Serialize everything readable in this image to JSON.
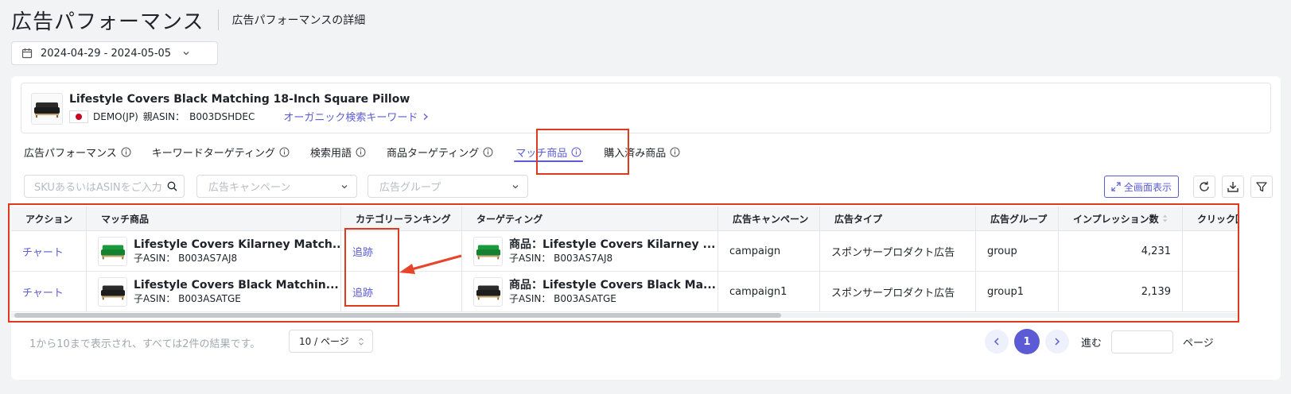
{
  "header": {
    "title": "広告パフォーマンス",
    "subtitle": "広告パフォーマンスの詳細"
  },
  "date_range": {
    "value": "2024-04-29 - 2024-05-05"
  },
  "product": {
    "name": "Lifestyle Covers Black Matching 18-Inch Square Pillow",
    "store": "DEMO(JP)",
    "parent_asin_label": "親ASIN：",
    "parent_asin": "B003DSHDEC",
    "organic_link": "オーガニック検索キーワード"
  },
  "tabs": [
    {
      "label": "広告パフォーマンス",
      "active": false
    },
    {
      "label": "キーワードターゲティング",
      "active": false
    },
    {
      "label": "検索用語",
      "active": false
    },
    {
      "label": "商品ターゲティング",
      "active": false
    },
    {
      "label": "マッチ商品",
      "active": true
    },
    {
      "label": "購入済み商品",
      "active": false
    }
  ],
  "filters": {
    "search_placeholder": "SKUあるいはASINをご入力",
    "campaign_placeholder": "広告キャンペーン",
    "adgroup_placeholder": "広告グループ"
  },
  "toolbar": {
    "fullscreen_label": "全画面表示"
  },
  "table": {
    "columns": [
      "アクション",
      "マッチ商品",
      "カテゴリーランキング",
      "ターゲティング",
      "広告キャンペーン",
      "広告タイプ",
      "広告グループ",
      "インプレッション数",
      "クリック回"
    ],
    "rows": [
      {
        "action": "チャート",
        "item_name": "Lifestyle Covers Kilarney Match...",
        "item_asin": "子ASIN：  B003AS7AJ8",
        "ranking": "追跡",
        "target_name": "商品：Lifestyle Covers Kilarney ...",
        "target_asin": "子ASIN：  B003AS7AJ8",
        "campaign": "campaign",
        "ad_type": "スポンサープロダクト広告",
        "ad_group": "group",
        "impressions": "4,231",
        "clicks": ""
      },
      {
        "action": "チャート",
        "item_name": "Lifestyle Covers Black Matchin...",
        "item_asin": "子ASIN：  B003ASATGE",
        "ranking": "追跡",
        "target_name": "商品：Lifestyle Covers Black Ma...",
        "target_asin": "子ASIN：  B003ASATGE",
        "campaign": "campaign1",
        "ad_type": "スポンサープロダクト広告",
        "ad_group": "group1",
        "impressions": "2,139",
        "clicks": ""
      }
    ]
  },
  "footer": {
    "result_text": "1から10まで表示され、すべては2件の結果です。",
    "page_size": "10 / ページ",
    "current_page": "1",
    "goto_label": "進む",
    "page_label": "ページ"
  },
  "colors": {
    "accent": "#5b5bd6",
    "highlight": "#e03a1e",
    "green_sofa": "#1a9a3c"
  }
}
